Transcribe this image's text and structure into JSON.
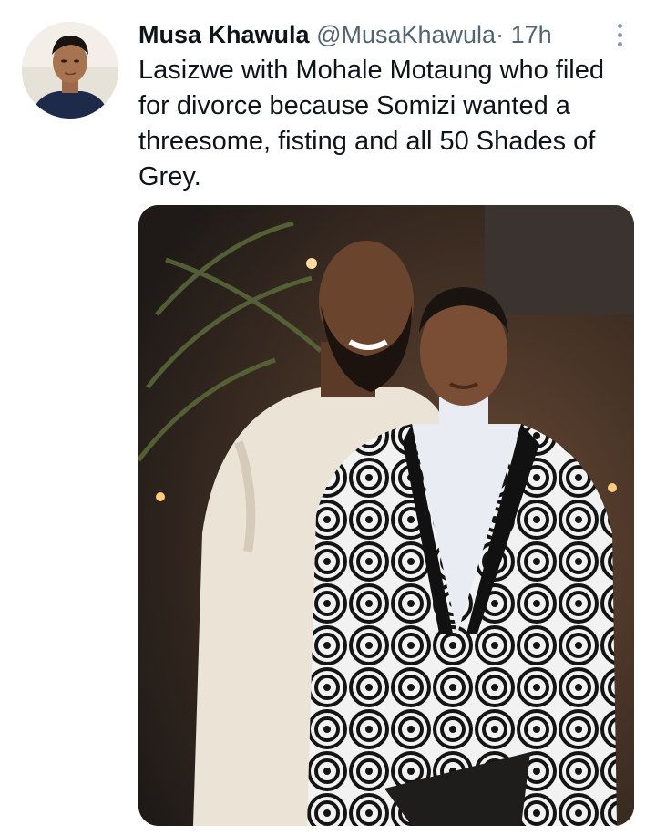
{
  "tweet": {
    "author_name": "Musa Khawula",
    "author_handle": "@MusaKhawula",
    "separator": "·",
    "time": "17h",
    "text": "Lasizwe with Mohale Motaung who filed for divorce because Somizi wanted a threesome, fisting and all 50 Shades of Grey.",
    "more_icon": "more-vertical-icon",
    "media_description_icon": "photo"
  },
  "colors": {
    "text_primary": "#0f1419",
    "text_secondary": "#536471",
    "background": "#ffffff"
  }
}
